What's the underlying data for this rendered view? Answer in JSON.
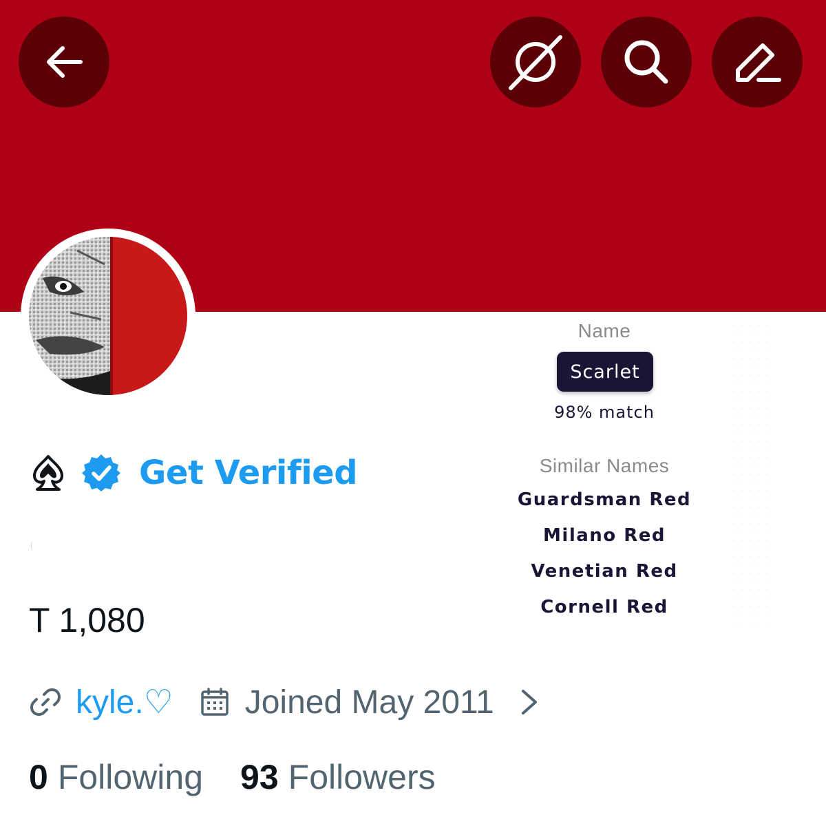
{
  "header": {
    "colors": {
      "banner": "#b00016",
      "button_bg": "#5c0008"
    },
    "buttons": [
      {
        "id": "back",
        "icon": "arrow-left-icon"
      },
      {
        "id": "grok",
        "icon": "grok-icon"
      },
      {
        "id": "search",
        "icon": "search-icon"
      },
      {
        "id": "edit",
        "icon": "edit-pencil-icon"
      }
    ]
  },
  "profile": {
    "avatar": "album-art-avatar",
    "name_icons": [
      "spade-icon",
      "verified-badge-icon"
    ],
    "get_verified_label": "Get Verified",
    "t_count": "T 1,080",
    "link_text": "kyle.♡",
    "joined_text": "Joined May 2011",
    "following_count": "0",
    "following_label": "Following",
    "followers_count": "93",
    "followers_label": "Followers"
  },
  "color_panel": {
    "name_label": "Name",
    "name_value": "Scarlet",
    "match": "98% match",
    "similar_label": "Similar Names",
    "similar": [
      "Guardsman Red",
      "Milano Red",
      "Venetian Red",
      "Cornell Red"
    ]
  }
}
